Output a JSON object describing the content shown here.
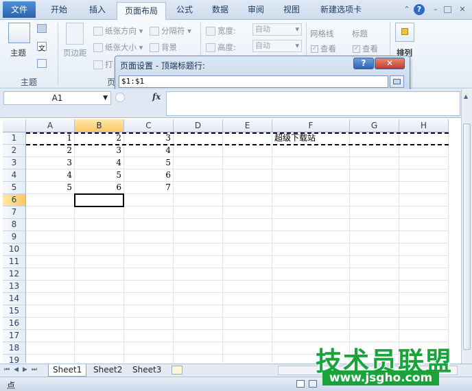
{
  "tabs": [
    "文件",
    "开始",
    "插入",
    "页面布局",
    "公式",
    "数据",
    "审阅",
    "视图",
    "新建选项卡"
  ],
  "ribbon": {
    "theme_label": "主题",
    "theme_group_label": "主题",
    "margins_label": "页边距",
    "orientation_label": "纸张方向",
    "size_label": "纸张大小",
    "print_area_label": "打",
    "breaks_label": "分隔符",
    "background_label": "背景",
    "page_group_label": "页",
    "width_label": "宽度:",
    "height_label": "高度:",
    "width_value": "自动",
    "height_value": "自动",
    "gridlines_label": "网格线",
    "headings_label": "标题",
    "view_gridlines_label": "查看",
    "view_headings_label": "查看",
    "arrange_label": "排列"
  },
  "dialog": {
    "title": "页面设置 - 顶端标题行:",
    "help": "?",
    "close": "✕",
    "value": "$1:$1"
  },
  "formula_bar": {
    "name_box": "A1",
    "fx": "fx",
    "formula": ""
  },
  "sheet": {
    "columns": [
      "A",
      "B",
      "C",
      "D",
      "E",
      "F",
      "G",
      "H"
    ],
    "rows": [
      "1",
      "2",
      "3",
      "4",
      "5",
      "6",
      "7",
      "8",
      "9",
      "10",
      "11",
      "12",
      "13",
      "14",
      "15",
      "16",
      "17",
      "18",
      "19"
    ],
    "cells": [
      [
        "1",
        "2",
        "3",
        "",
        "",
        "超级下载站",
        "",
        ""
      ],
      [
        "2",
        "3",
        "4",
        "",
        "",
        "",
        "",
        ""
      ],
      [
        "3",
        "4",
        "5",
        "",
        "",
        "",
        "",
        ""
      ],
      [
        "4",
        "5",
        "6",
        "",
        "",
        "",
        "",
        ""
      ],
      [
        "5",
        "6",
        "7",
        "",
        "",
        "",
        "",
        ""
      ]
    ]
  },
  "sheet_tabs": [
    "Sheet1",
    "Sheet2",
    "Sheet3"
  ],
  "status": {
    "mode": "点"
  },
  "watermark": {
    "line1": "技术员联盟",
    "line2": "www.jsgho.com"
  },
  "colors": {
    "ribbon_active": "#f5f8fc",
    "file_tab": "#2a64ad",
    "selection_header": "#f9c864",
    "watermark": "#1aa33a"
  }
}
